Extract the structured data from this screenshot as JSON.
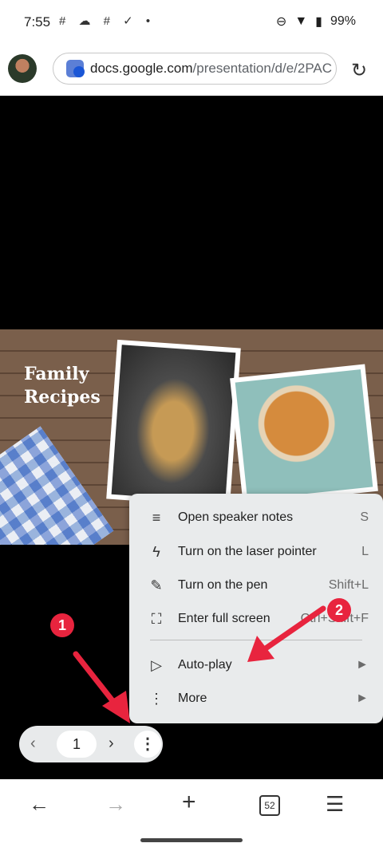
{
  "status_bar": {
    "time": "7:55",
    "notification_icons": "# ☁ # ✓ •",
    "battery": "99%"
  },
  "browser": {
    "url_host": "docs.google.com",
    "url_path": "/presentation/d/e/2PAC"
  },
  "slide": {
    "title_line1": "Family",
    "title_line2": "Recipes"
  },
  "menu": {
    "items": [
      {
        "icon": "notes-icon",
        "glyph": "≡",
        "label": "Open speaker notes",
        "shortcut": "S"
      },
      {
        "icon": "laser-pointer-icon",
        "glyph": "ϟ",
        "label": "Turn on the laser pointer",
        "shortcut": "L"
      },
      {
        "icon": "pen-icon",
        "glyph": "✎",
        "label": "Turn on the pen",
        "shortcut": "Shift+L"
      },
      {
        "icon": "fullscreen-icon",
        "glyph": "⛶",
        "label": "Enter full screen",
        "shortcut": "Ctrl+Shift+F"
      },
      {
        "icon": "play-icon",
        "glyph": "▷",
        "label": "Auto-play",
        "shortcut": "►"
      },
      {
        "icon": "more-vert-icon",
        "glyph": "⋮",
        "label": "More",
        "shortcut": "►"
      }
    ]
  },
  "pager": {
    "page": "1"
  },
  "annotations": {
    "badge1": "1",
    "badge2": "2"
  },
  "bottom_nav": {
    "tab_count": "52"
  },
  "colors": {
    "accent_red": "#e8243e",
    "menu_bg": "#e9ebec"
  }
}
